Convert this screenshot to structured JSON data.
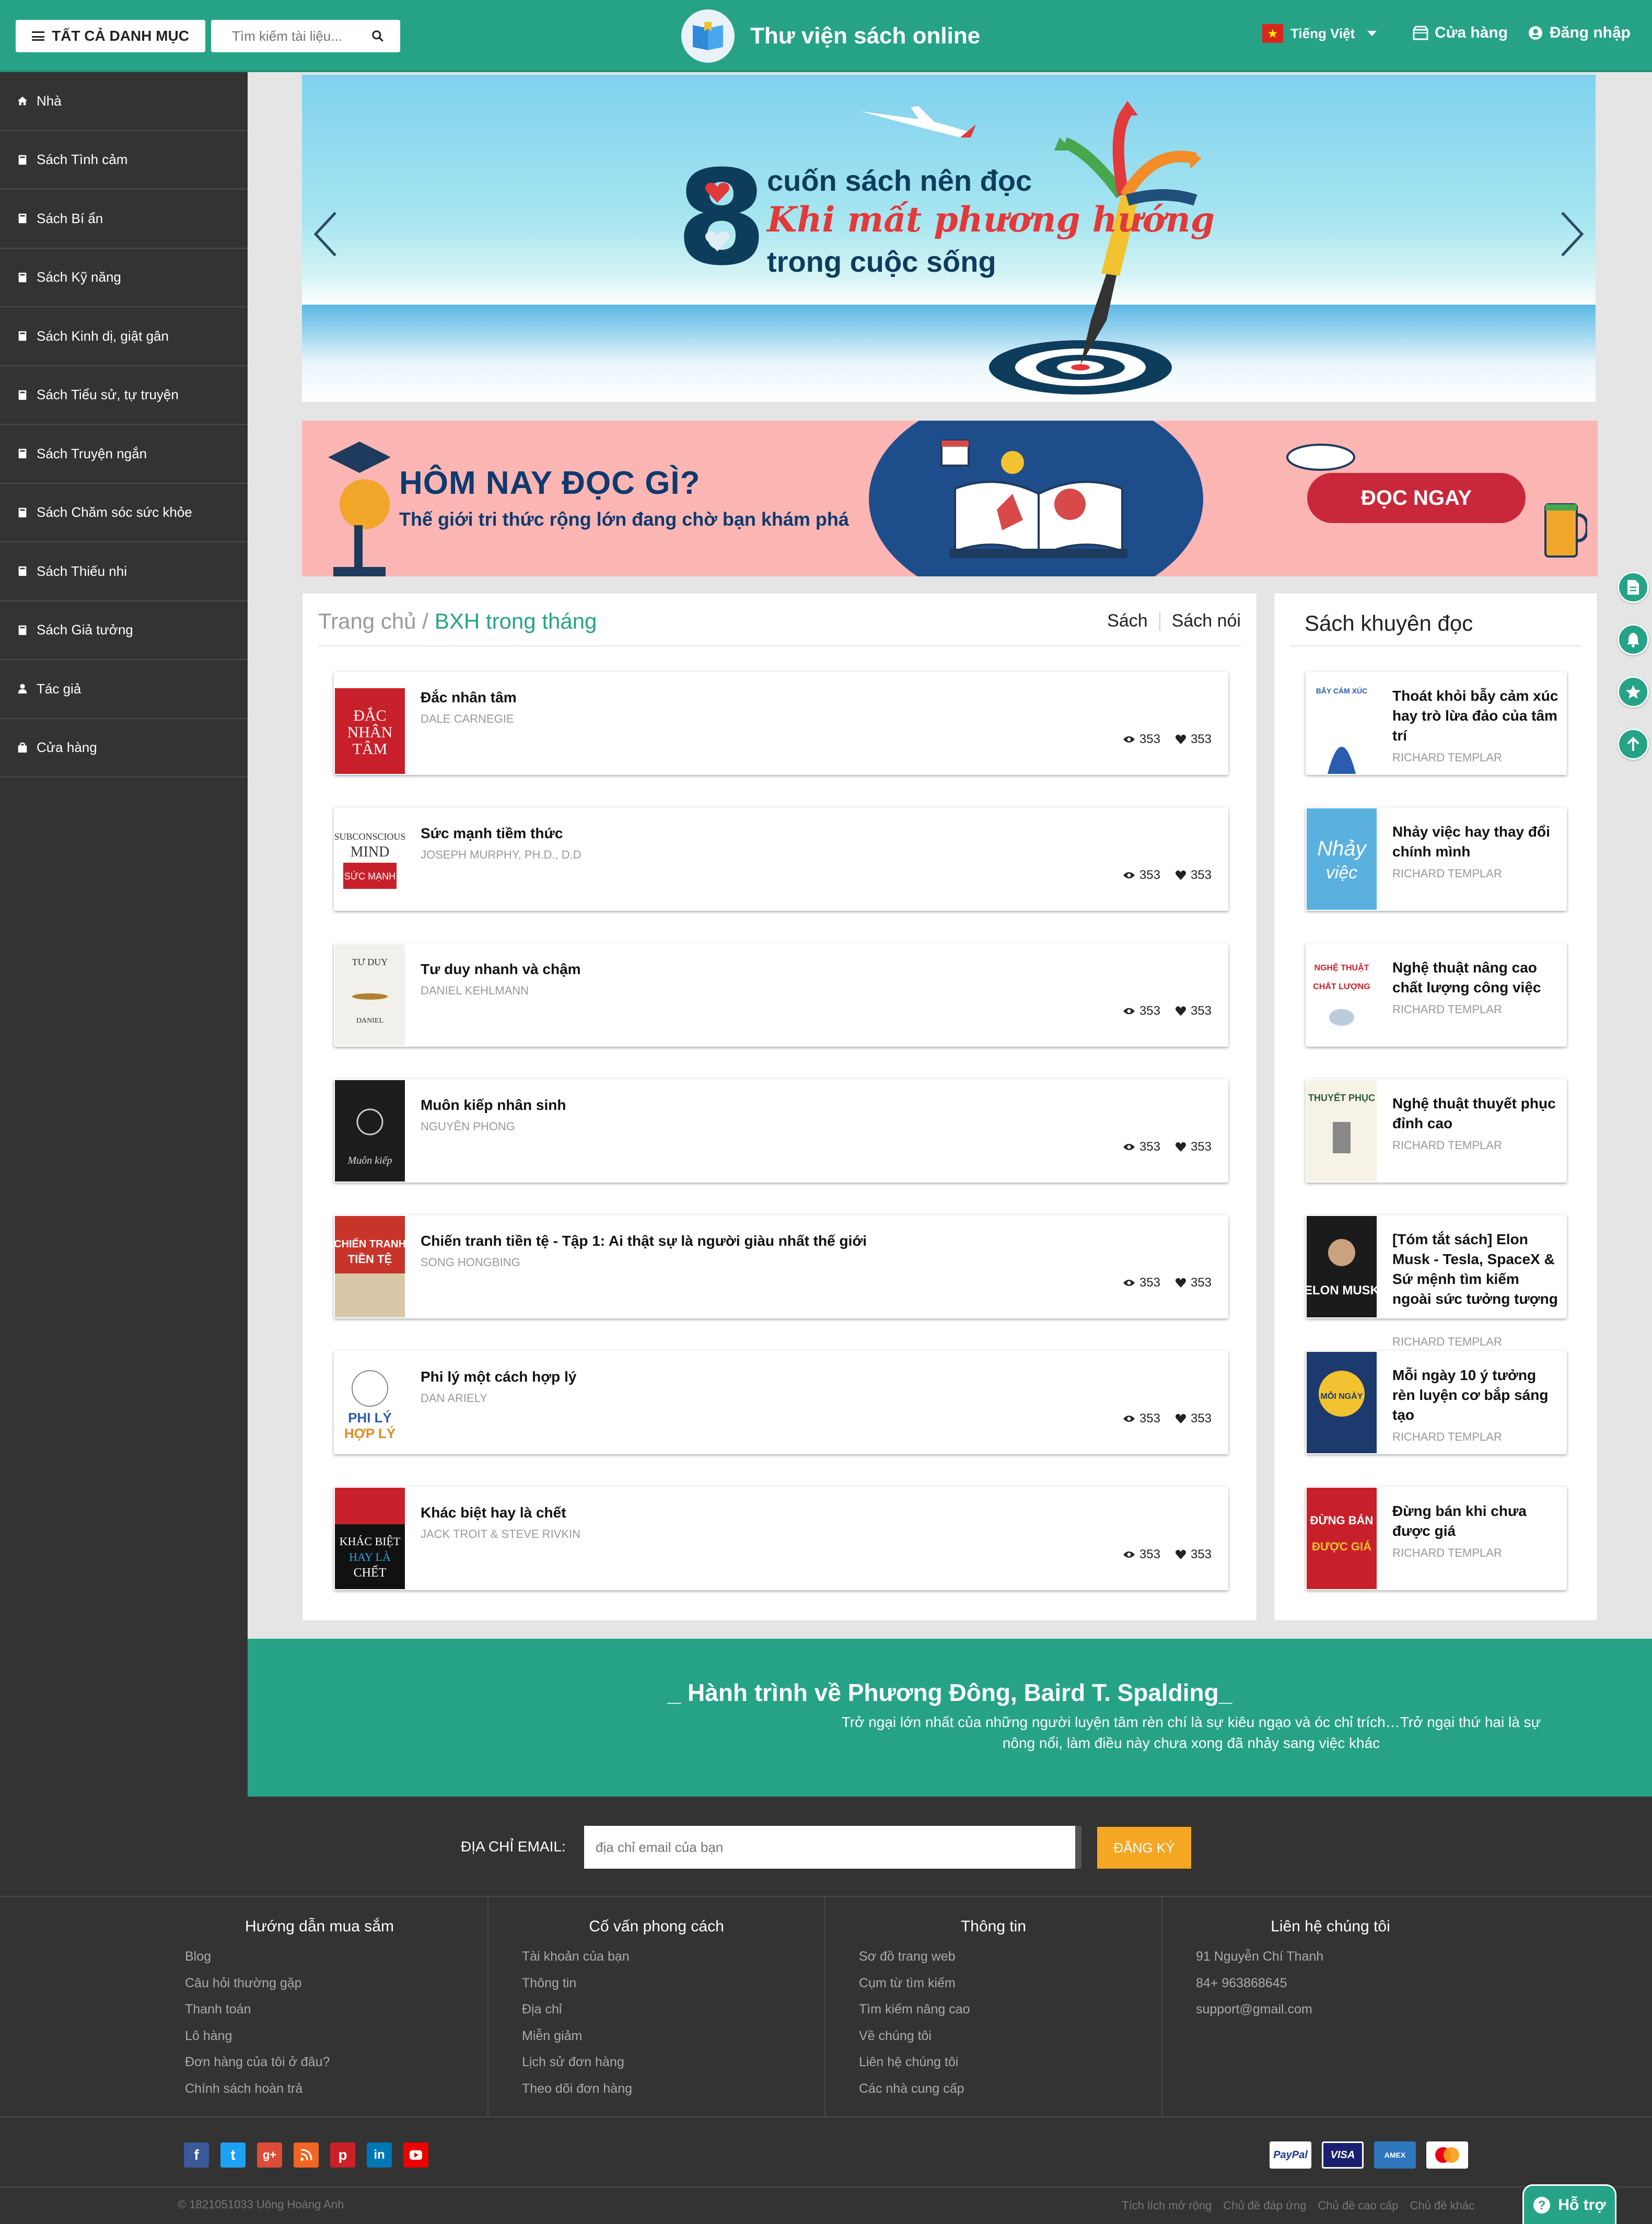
{
  "header": {
    "categories_label": "TẤT CẢ DANH MỤC",
    "search_placeholder": "Tìm kiếm tài liệu...",
    "site_title": "Thư viện sách online",
    "language": "Tiếng Việt",
    "store_label": "Cửa hàng",
    "login_label": "Đăng nhập",
    "brand_color": "#26a386"
  },
  "sidebar": {
    "items": [
      {
        "label": "Nhà",
        "icon": "home-icon"
      },
      {
        "label": "Sách Tình cảm",
        "icon": "book-icon"
      },
      {
        "label": "Sách Bí ẩn",
        "icon": "book-icon"
      },
      {
        "label": "Sách Kỹ năng",
        "icon": "book-icon"
      },
      {
        "label": "Sách Kinh dị, giật gân",
        "icon": "book-icon"
      },
      {
        "label": "Sách Tiểu sử, tự truyện",
        "icon": "book-icon"
      },
      {
        "label": "Sách Truyện ngắn",
        "icon": "book-icon"
      },
      {
        "label": "Sách Chăm sóc sức khỏe",
        "icon": "book-icon"
      },
      {
        "label": "Sách Thiếu nhi",
        "icon": "book-icon"
      },
      {
        "label": "Sách Giả tưởng",
        "icon": "book-icon"
      },
      {
        "label": "Tác giả",
        "icon": "person-icon"
      },
      {
        "label": "Cửa hàng",
        "icon": "bag-icon"
      }
    ]
  },
  "slider": {
    "number": "8",
    "line1": "cuốn sách nên đọc",
    "line2": "Khi mất phương hướng",
    "line3": "trong cuộc sống"
  },
  "promo": {
    "title": "HÔM NAY ĐỌC GÌ?",
    "subtitle": "Thế giới tri thức rộng lớn đang chờ bạn khám phá",
    "button": "ĐỌC NGAY"
  },
  "ranking": {
    "breadcrumb_home": "Trang chủ /",
    "breadcrumb_current": "BXH trong tháng",
    "tab_books": "Sách",
    "tab_audio": "Sách nói",
    "books": [
      {
        "title": "Đắc nhân tâm",
        "author": "DALE CARNEGIE",
        "views": "353",
        "likes": "353"
      },
      {
        "title": "Sức mạnh tiềm thức",
        "author": "JOSEPH MURPHY, PH.D., D.D",
        "views": "353",
        "likes": "353"
      },
      {
        "title": "Tư duy nhanh và chậm",
        "author": "DANIEL KEHLMANN",
        "views": "353",
        "likes": "353"
      },
      {
        "title": "Muôn kiếp nhân sinh",
        "author": "NGUYÊN PHONG",
        "views": "353",
        "likes": "353"
      },
      {
        "title": "Chiến tranh tiền tệ - Tập 1: Ai thật sự là người giàu nhất thế giới",
        "author": "SONG HONGBING",
        "views": "353",
        "likes": "353"
      },
      {
        "title": "Phi lý một cách hợp lý",
        "author": "DAN ARIELY",
        "views": "353",
        "likes": "353"
      },
      {
        "title": "Khác biệt hay là chết",
        "author": "JACK TROIT & STEVE RIVKIN",
        "views": "353",
        "likes": "353"
      }
    ]
  },
  "recommended": {
    "title": "Sách khuyên đọc",
    "books": [
      {
        "title": "Thoát khỏi bẫy cảm xúc hay trò lừa đảo của tâm trí",
        "author": "RICHARD TEMPLAR"
      },
      {
        "title": "Nhảy việc hay thay đổi chính mình",
        "author": "RICHARD TEMPLAR"
      },
      {
        "title": "Nghệ thuật nâng cao chất lượng công việc",
        "author": "RICHARD TEMPLAR"
      },
      {
        "title": "Nghệ thuật thuyết phục đỉnh cao",
        "author": "RICHARD TEMPLAR"
      },
      {
        "title": "[Tóm tắt sách] Elon Musk - Tesla, SpaceX & Sứ mệnh tìm kiếm ngoài sức tưởng tượng",
        "author": "RICHARD TEMPLAR"
      },
      {
        "title": "Mỗi ngày 10 ý tưởng rèn luyện cơ bắp sáng tạo",
        "author": "RICHARD TEMPLAR"
      },
      {
        "title": "Đừng bán khi chưa được giá",
        "author": "RICHARD TEMPLAR"
      }
    ]
  },
  "quote": {
    "title": "_ Hành trình về Phương Đông, Baird T. Spalding_",
    "text": "Trở ngại lớn nhất của những người luyện tâm rèn chí là sự kiêu ngạo và óc chỉ trích…Trở ngại thứ hai là sự nông nổi, làm điều này chưa xong đã nhảy sang việc khác"
  },
  "newsletter": {
    "label": "ĐỊA CHỈ EMAIL:",
    "placeholder": "địa chỉ email của bạn",
    "button": "ĐĂNG KÝ"
  },
  "footer_columns": [
    {
      "title": "Hướng dẫn mua sắm",
      "links": [
        "Blog",
        "Câu hỏi thường gặp",
        "Thanh toán",
        "Lô hàng",
        "Đơn hàng của tôi ở đâu?",
        "Chính sách hoàn trả"
      ]
    },
    {
      "title": "Cố vấn phong cách",
      "links": [
        "Tài khoản của bạn",
        "Thông tin",
        "Địa chỉ",
        "Miễn giảm",
        "Lịch sử đơn hàng",
        "Theo dõi đơn hàng"
      ]
    },
    {
      "title": "Thông tin",
      "links": [
        "Sơ đồ trang web",
        "Cụm từ tìm kiếm",
        "Tìm kiếm nâng cao",
        "Về chúng tôi",
        "Liên hệ chúng tôi",
        "Các nhà cung cấp"
      ]
    },
    {
      "title": "Liên hệ chúng tôi",
      "links": [
        "91 Nguyễn Chí Thanh",
        "84+ 963868645",
        "support@gmail.com"
      ]
    }
  ],
  "social": [
    "f",
    "t",
    "g+",
    "rss",
    "p",
    "in",
    "yt"
  ],
  "payments": [
    "PayPal",
    "VISA",
    "AMEX",
    "MasterCard"
  ],
  "copyright": "© 1821051033 Uông Hoàng Anh",
  "footer_links": [
    "Tích lích mở rộng",
    "Chủ đề đáp ứng",
    "Chủ đề cao cấp",
    "Chủ đề khác"
  ],
  "help_label": "Hỗ trợ"
}
